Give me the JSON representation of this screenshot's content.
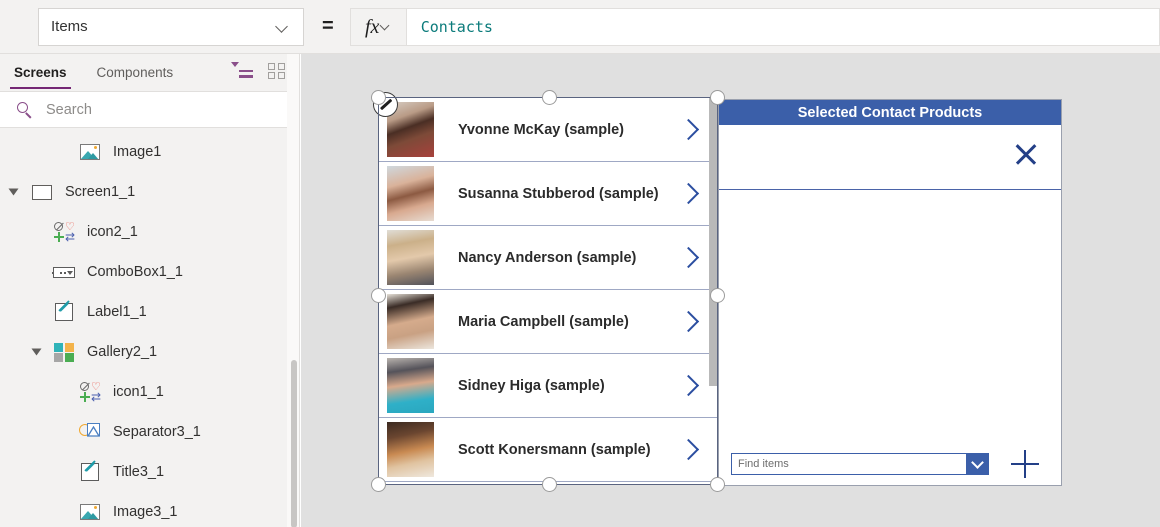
{
  "formula_bar": {
    "property": "Items",
    "equals": "=",
    "fx_label": "fx",
    "formula": "Contacts"
  },
  "left_panel": {
    "tabs": [
      {
        "label": "Screens",
        "active": true
      },
      {
        "label": "Components",
        "active": false
      }
    ],
    "view_icons": [
      "tree-view-icon",
      "grid-view-icon"
    ],
    "search": {
      "placeholder": "Search",
      "icon": "search-icon"
    },
    "tree": [
      {
        "label": "Image1",
        "icon": "image-control-icon",
        "indent": 2,
        "twisty": false
      },
      {
        "label": "Screen1_1",
        "icon": "screen-icon",
        "indent": 0,
        "twisty": true
      },
      {
        "label": "icon2_1",
        "icon": "icon-control-icon",
        "indent": 1,
        "twisty": false
      },
      {
        "label": "ComboBox1_1",
        "icon": "combobox-control-icon",
        "indent": 1,
        "twisty": false
      },
      {
        "label": "Label1_1",
        "icon": "label-control-icon",
        "indent": 1,
        "twisty": false
      },
      {
        "label": "Gallery2_1",
        "icon": "gallery-control-icon",
        "indent": 1,
        "twisty": true
      },
      {
        "label": "icon1_1",
        "icon": "icon-control-icon",
        "indent": 2,
        "twisty": false
      },
      {
        "label": "Separator3_1",
        "icon": "separator-control-icon",
        "indent": 2,
        "twisty": false
      },
      {
        "label": "Title3_1",
        "icon": "label-control-icon",
        "indent": 2,
        "twisty": false
      },
      {
        "label": "Image3_1",
        "icon": "image-control-icon",
        "indent": 2,
        "twisty": false
      }
    ]
  },
  "canvas": {
    "gallery": {
      "selected": true,
      "items": [
        {
          "name": "Yvonne McKay (sample)",
          "chevron": "chevron-right-icon",
          "edit_badge": true
        },
        {
          "name": "Susanna Stubberod (sample)",
          "chevron": "chevron-right-icon",
          "edit_badge": false
        },
        {
          "name": "Nancy Anderson (sample)",
          "chevron": "chevron-right-icon",
          "edit_badge": false
        },
        {
          "name": "Maria Campbell (sample)",
          "chevron": "chevron-right-icon",
          "edit_badge": false
        },
        {
          "name": "Sidney Higa (sample)",
          "chevron": "chevron-right-icon",
          "edit_badge": false
        },
        {
          "name": "Scott Konersmann (sample)",
          "chevron": "chevron-right-icon",
          "edit_badge": false
        }
      ]
    },
    "right_panel": {
      "title": "Selected Contact Products",
      "close_icon": "close-x-icon",
      "combo_placeholder": "Find items",
      "combo_dropdown_icon": "chevron-down-icon",
      "add_icon": "plus-icon"
    }
  },
  "colors": {
    "accent_purple": "#742774",
    "panel_blue": "#3b5fa9",
    "chevron_navy": "#2b4ea0",
    "formula_teal": "#0b7b7b",
    "canvas_bg": "#e0e0e0",
    "chrome_bg": "#f3f2f1"
  }
}
